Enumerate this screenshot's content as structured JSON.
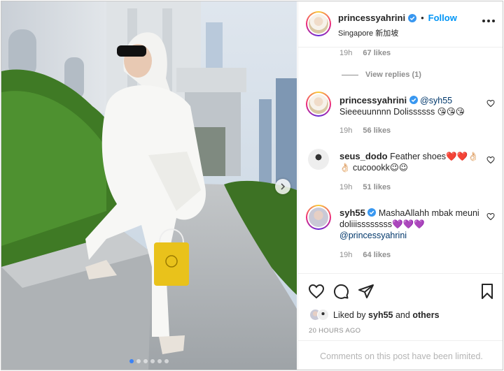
{
  "post": {
    "username": "princessyahrini",
    "follow_label": "Follow",
    "separator": "•",
    "location": "Singapore 新加坡"
  },
  "comments": {
    "top_meta": {
      "time": "19h",
      "likes": "67 likes"
    },
    "view_replies": "View replies (1)",
    "items": [
      {
        "username": "princessyahrini",
        "mention": "@syh55",
        "text": "Sieeeuunnnn Dolissssss 😘😘😘",
        "time": "19h",
        "likes": "56 likes"
      },
      {
        "username": "seus_dodo",
        "text": "Feather shoes❤️❤️👌🏻👌🏻 cucoookk😉😉",
        "time": "19h",
        "likes": "51 likes"
      },
      {
        "username": "syh55",
        "text": "MashaAllahh mbak meuni doliiissssssss💜💜💜",
        "mention": "@princessyahrini",
        "time": "19h",
        "likes": "64 likes"
      }
    ]
  },
  "likes": {
    "prefix": "Liked by",
    "user": "syh55",
    "and": "and",
    "others": "others"
  },
  "timestamp": "20 HOURS AGO",
  "comments_limited": "Comments on this post have been limited.",
  "carousel": {
    "count": 6,
    "active_index": 0
  },
  "icons": {
    "verified": "verified-badge-icon",
    "more": "more-options-icon",
    "heart": "heart-icon",
    "comment": "comment-icon",
    "share": "share-icon",
    "save": "bookmark-icon",
    "next": "chevron-right-icon"
  },
  "colors": {
    "accent": "#0095f6",
    "verified": "#3897f0",
    "text": "#262626",
    "muted": "#8e8e8e"
  }
}
